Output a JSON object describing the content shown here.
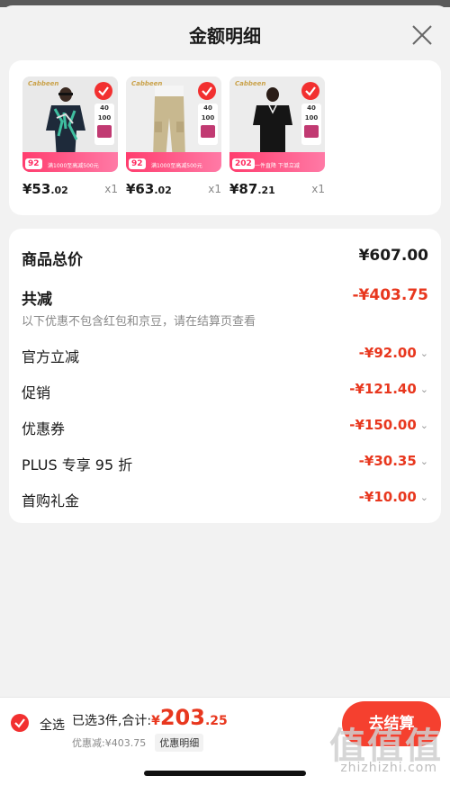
{
  "header": {
    "title": "金额明细"
  },
  "products": [
    {
      "price_int": "¥53",
      "price_dec": ".02",
      "qty": "x1",
      "badge_price": "92",
      "promo": "满1000至高减500元",
      "stat1": "40",
      "stat2": "100"
    },
    {
      "price_int": "¥63",
      "price_dec": ".02",
      "qty": "x1",
      "badge_price": "92",
      "promo": "满1000至高减500元",
      "stat1": "40",
      "stat2": "100"
    },
    {
      "price_int": "¥87",
      "price_dec": ".21",
      "qty": "x1",
      "badge_price": "202",
      "promo": "一件直降 下单立减",
      "stat1": "40",
      "stat2": "100"
    }
  ],
  "summary": {
    "total_label": "商品总价",
    "total_value": "¥607.00",
    "reduce_label": "共减",
    "reduce_value": "-¥403.75",
    "note": "以下优惠不包含红包和京豆，请在结算页查看",
    "items": [
      {
        "label": "官方立减",
        "value": "-¥92.00"
      },
      {
        "label": "促销",
        "value": "-¥121.40"
      },
      {
        "label": "优惠券",
        "value": "-¥150.00"
      },
      {
        "label": "PLUS 专享 95 折",
        "value": "-¥30.35"
      },
      {
        "label": "首购礼金",
        "value": "-¥10.00"
      }
    ]
  },
  "bottom": {
    "select_all": "全选",
    "sum_label": "已选3件,合计:",
    "sum_currency": "¥",
    "sum_int": "203",
    "sum_dec": ".25",
    "save_text": "优惠减:¥403.75",
    "detail_button": "优惠明细",
    "checkout": "去结算"
  },
  "watermark": {
    "text": "值值值",
    "sub": "zhizhizhi.com"
  },
  "colors": {
    "accent": "#e8371e",
    "check": "#f23030",
    "badge": "#ff3d6e"
  }
}
